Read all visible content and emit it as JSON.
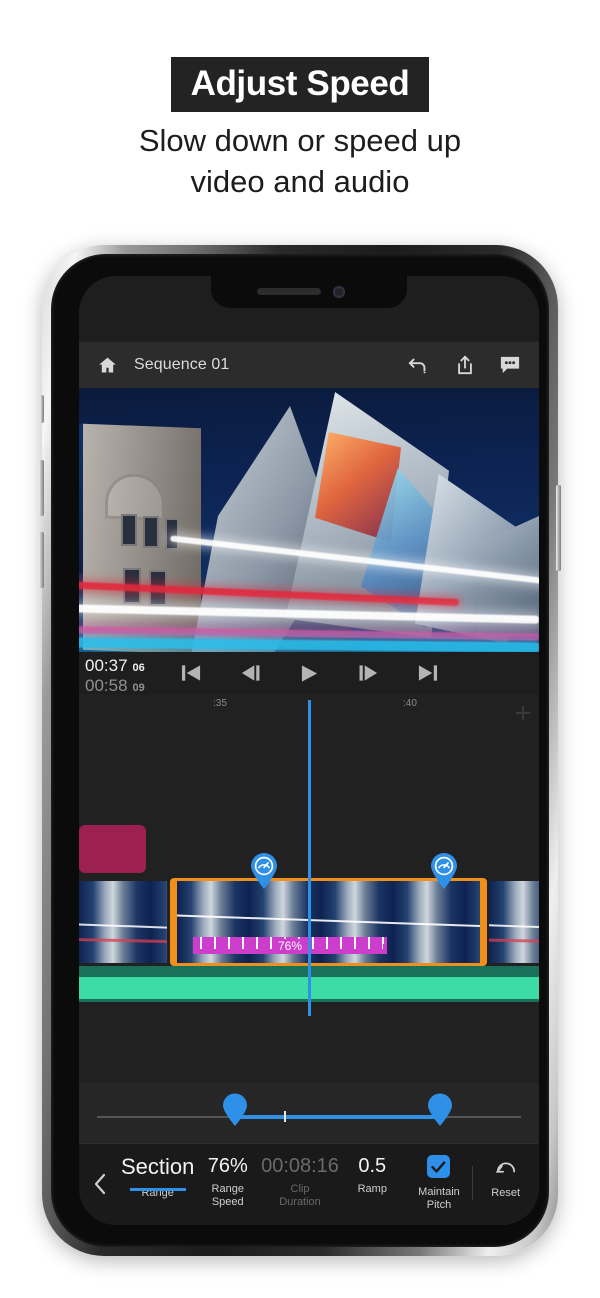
{
  "promo": {
    "title": "Adjust Speed",
    "subtitle_line1": "Slow down or speed up",
    "subtitle_line2": "video and audio"
  },
  "appbar": {
    "home_icon": "home-icon",
    "sequence_title": "Sequence 01",
    "undo_icon": "undo-icon",
    "share_icon": "share-icon",
    "comment_icon": "comment-icon"
  },
  "preview": {
    "description": "night photo of museum with light trails"
  },
  "transport": {
    "current_time": "00:37",
    "current_frames": "06",
    "duration_time": "00:58",
    "duration_frames": "09",
    "buttons": [
      {
        "name": "skip-to-start",
        "icon": "skip-back-icon"
      },
      {
        "name": "step-back",
        "icon": "step-back-icon"
      },
      {
        "name": "play",
        "icon": "play-icon"
      },
      {
        "name": "step-forward",
        "icon": "step-forward-icon"
      },
      {
        "name": "skip-to-end",
        "icon": "skip-forward-icon"
      }
    ]
  },
  "timeline": {
    "ruler_marks": [
      ":35",
      ":40"
    ],
    "add_icon": "plus-icon",
    "speed_label": "76%",
    "speed_pin_icon": "speedometer-icon",
    "selection_color": "#f0901a",
    "speedbar_color": "#cc3dcc",
    "title_clip_color": "#9c2051",
    "audio_track_color": "#19715c",
    "waveform_color": "#3ddba5",
    "playhead_color": "#2f90e8"
  },
  "range_slider": {
    "left_handle_icon": "pin-handle-icon",
    "right_handle_icon": "pin-handle-icon",
    "fill_color": "#2f90e8"
  },
  "toolbar": {
    "back_icon": "chevron-left-icon",
    "items": [
      {
        "value": "Section",
        "label": "Range",
        "active": true,
        "dim": false
      },
      {
        "value": "76%",
        "label": "Range\nSpeed",
        "active": false,
        "dim": false
      },
      {
        "value": "00:08:16",
        "label": "Clip\nDuration",
        "active": false,
        "dim": true
      },
      {
        "value": "0.5",
        "label": "Ramp",
        "active": false,
        "dim": false
      }
    ],
    "maintain_pitch": {
      "label_line1": "Maintain",
      "label_line2": "Pitch",
      "checked": true,
      "icon": "checkbox-checked-icon"
    },
    "reset": {
      "label": "Reset",
      "icon": "reset-undo-icon"
    }
  }
}
